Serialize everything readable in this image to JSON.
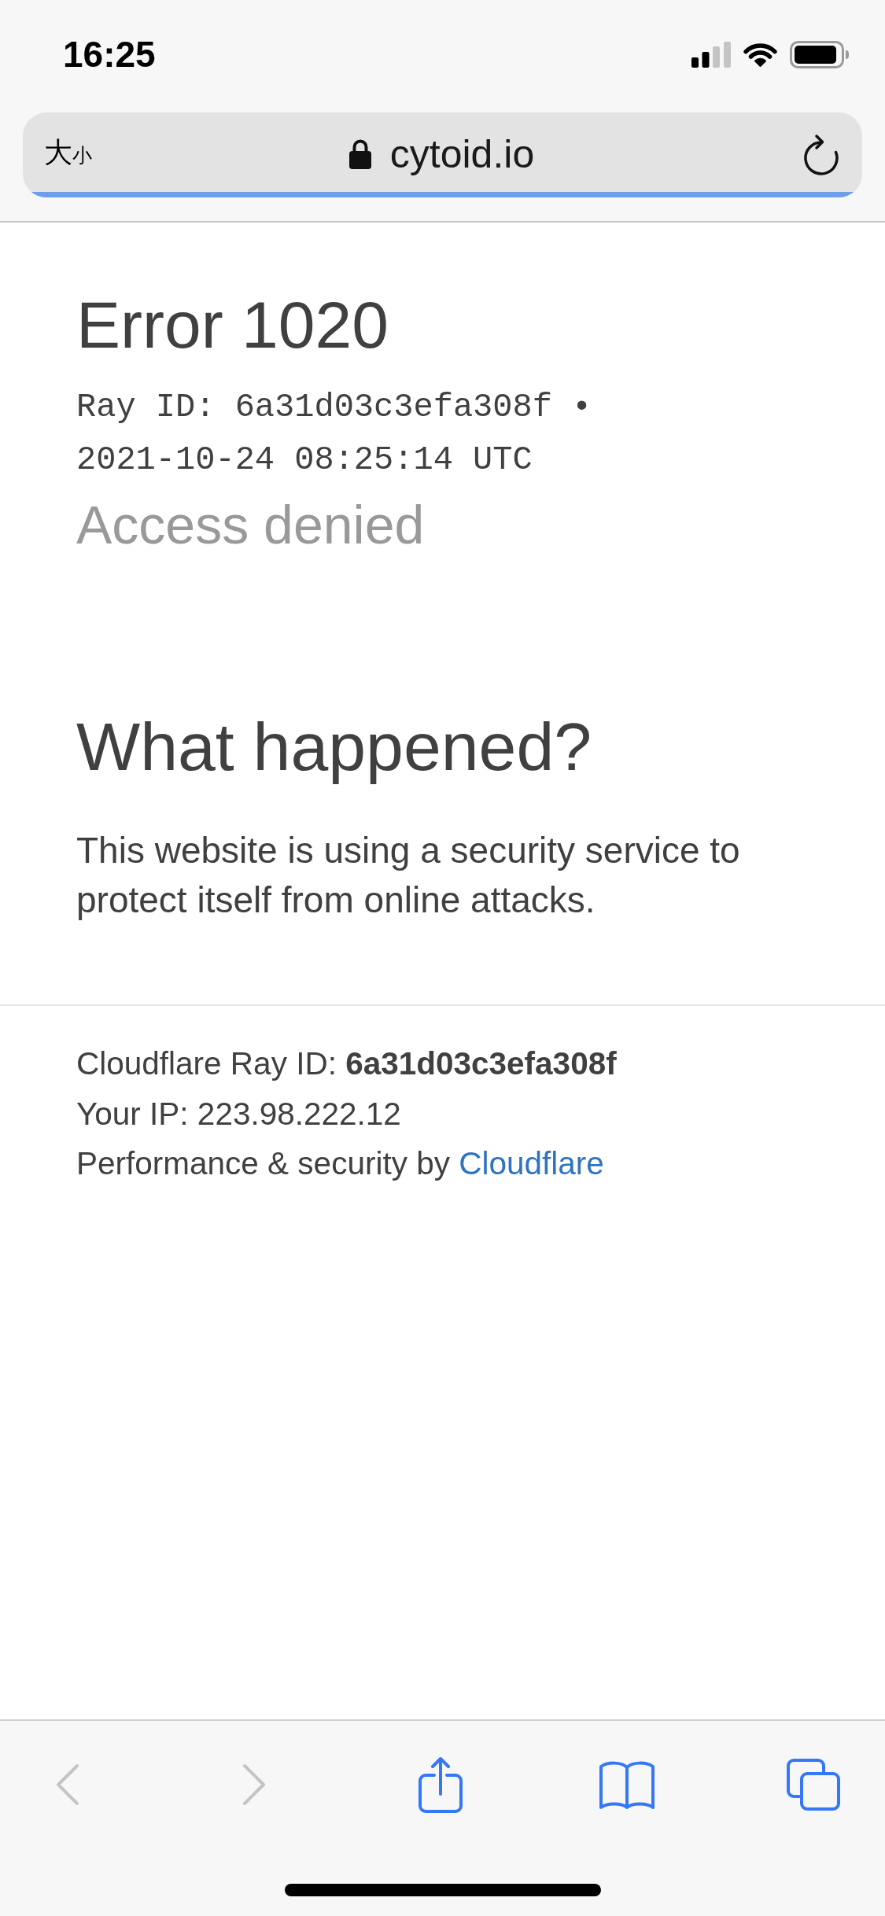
{
  "status_bar": {
    "time": "16:25"
  },
  "address_bar": {
    "text_size": "大$_{小}$",
    "url": "cytoid.io",
    "progress": {
      "level": 1
    }
  },
  "error": {
    "title": "Error 1020",
    "ray_id": "Ray ID: 6a31d03c3efa308f •",
    "timestamp": "2021-10-24 08:25:14 UTC",
    "subtitle": "Access denied"
  },
  "section": {
    "heading": "What happened?",
    "body": "This website is using a security service to protect itself from online attacks."
  },
  "footer": {
    "ray_id": "Cloudflare Ray ID: **6a31d03c3efa308f**",
    "ip": "Your IP: 223.98.222.12",
    "credit": "Performance & security by",
    "credit_link": "Cloudflare"
  },
  "toolbar": {
    "buttons": [
      {
        "kind": "back",
        "disabled": true
      },
      {
        "kind": "forward",
        "disabled": true
      },
      {
        "kind": "share",
        "disabled": false
      },
      {
        "kind": "bookmarks",
        "disabled": false
      },
      {
        "kind": "tabs",
        "disabled": false
      }
    ]
  }
}
